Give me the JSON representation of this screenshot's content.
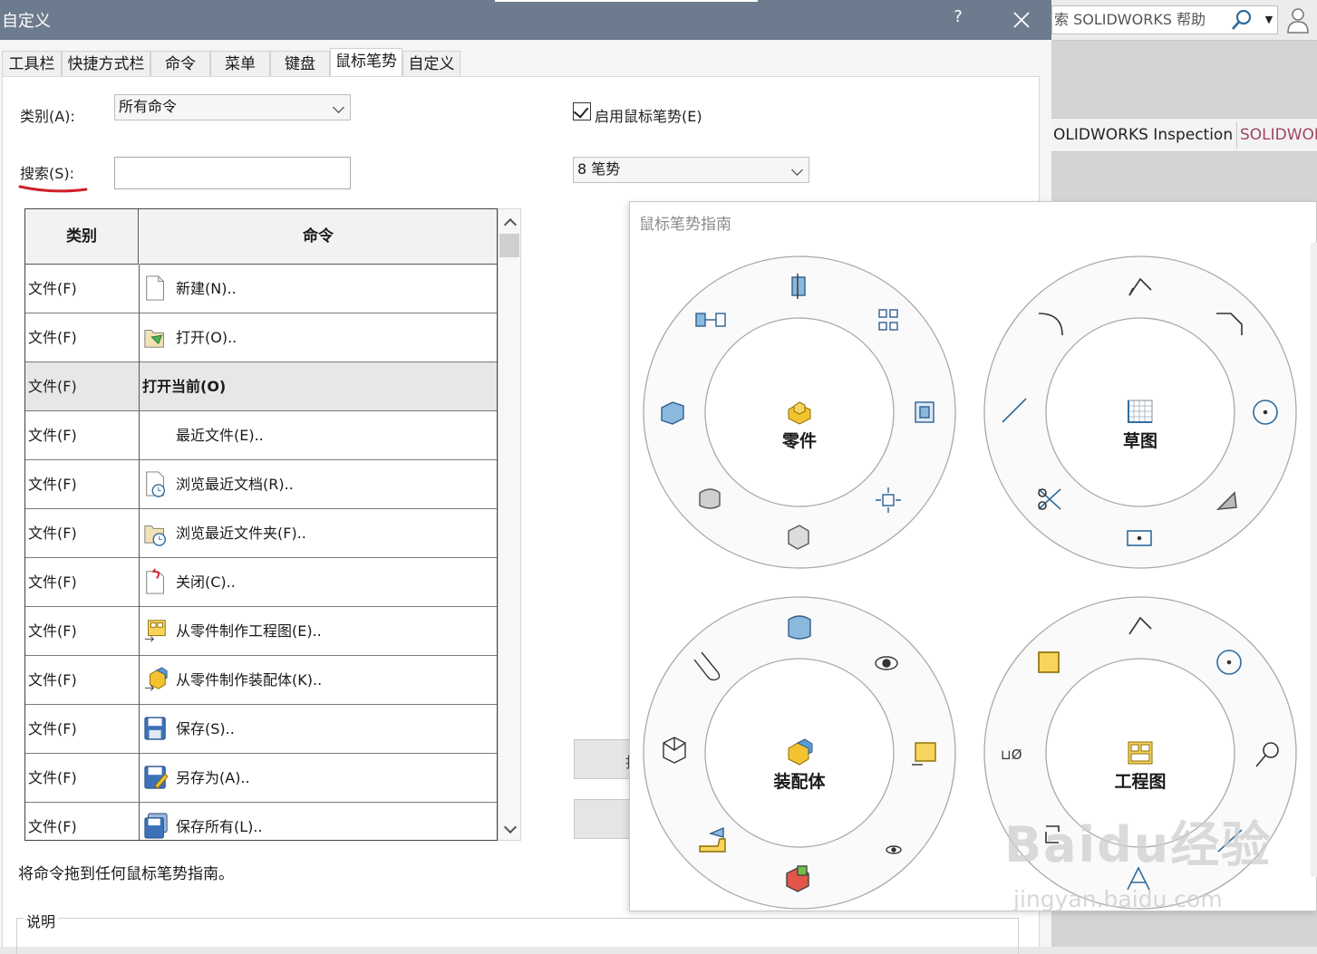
{
  "background_app": {
    "help_search": "索 SOLIDWORKS 帮助",
    "tab_inspection": "OLIDWORKS Inspection",
    "tab_cut": "SOLIDWOR"
  },
  "dialog": {
    "title": "自定义",
    "help_glyph": "?",
    "tabs": [
      {
        "label": "工具栏"
      },
      {
        "label": "快捷方式栏"
      },
      {
        "label": "命令"
      },
      {
        "label": "菜单"
      },
      {
        "label": "键盘"
      },
      {
        "label": "鼠标笔势"
      },
      {
        "label": "自定义"
      }
    ],
    "active_tab": "鼠标笔势",
    "category_label": "类别(A):",
    "category_value": "所有命令",
    "search_label": "搜索(S):",
    "search_value": "",
    "enable_label": "启用鼠标笔势(E)",
    "enable_checked": true,
    "gesture_count": "8 笔势",
    "hidden_button_1": "指",
    "table": {
      "headers": [
        "类别",
        "命令"
      ],
      "rows": [
        {
          "category": "文件(F)",
          "command": "新建(N)..",
          "icon": "new-document-icon"
        },
        {
          "category": "文件(F)",
          "command": "打开(O)..",
          "icon": "open-folder-icon"
        },
        {
          "category": "文件(F)",
          "command": "打开当前(O)",
          "icon": "",
          "selected": true
        },
        {
          "category": "文件(F)",
          "command": "最近文件(E)..",
          "icon": ""
        },
        {
          "category": "文件(F)",
          "command": "浏览最近文档(R)..",
          "icon": "recent-documents-icon"
        },
        {
          "category": "文件(F)",
          "command": "浏览最近文件夹(F)..",
          "icon": "recent-folders-icon"
        },
        {
          "category": "文件(F)",
          "command": "关闭(C)..",
          "icon": "close-document-icon"
        },
        {
          "category": "文件(F)",
          "command": "从零件制作工程图(E)..",
          "icon": "make-drawing-icon"
        },
        {
          "category": "文件(F)",
          "command": "从零件制作装配体(K)..",
          "icon": "make-assembly-icon"
        },
        {
          "category": "文件(F)",
          "command": "保存(S)..",
          "icon": "save-icon"
        },
        {
          "category": "文件(F)",
          "command": "另存为(A)..",
          "icon": "save-as-icon"
        },
        {
          "category": "文件(F)",
          "command": "保存所有(L)..",
          "icon": "save-all-icon"
        }
      ]
    },
    "drag_hint": "将命令拖到任何鼠标笔势指南。",
    "description_label": "说明"
  },
  "gesture_guide": {
    "title": "鼠标笔势指南",
    "rings": [
      {
        "label": "零件"
      },
      {
        "label": "草图"
      },
      {
        "label": "装配体"
      },
      {
        "label": "工程图"
      }
    ]
  },
  "watermark": {
    "main": "Baidu经验",
    "sub": "jingyan.baidu.com"
  },
  "colors": {
    "titlebar": "#6d7b8e",
    "accent_yellow": "#f2c230",
    "icon_blue": "#2f6c9e",
    "annotation_red": "#d0202a"
  }
}
